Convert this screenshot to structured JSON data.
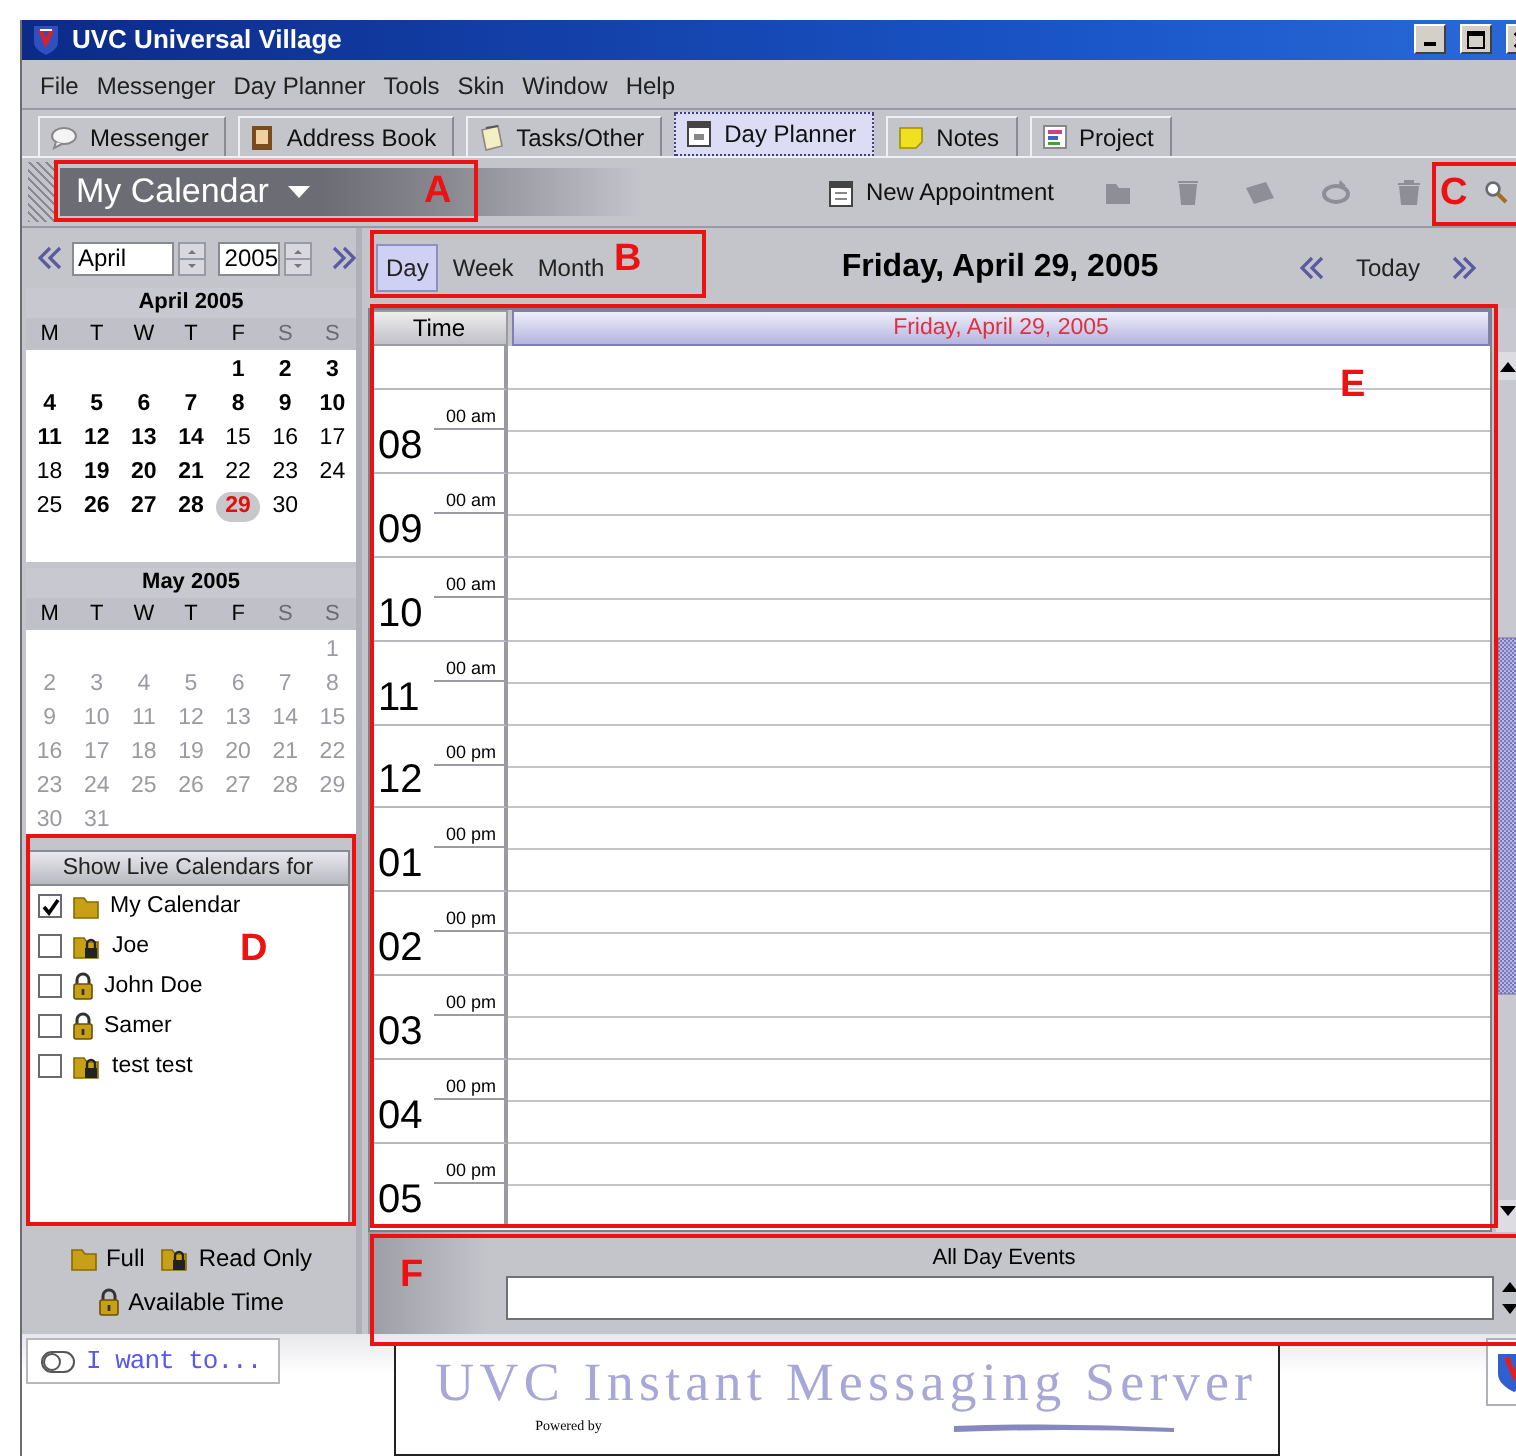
{
  "window": {
    "title": "UVC Universal Village"
  },
  "menu": [
    {
      "label": "File"
    },
    {
      "label": "Messenger"
    },
    {
      "label": "Day Planner"
    },
    {
      "label": "Tools"
    },
    {
      "label": "Skin"
    },
    {
      "label": "Window"
    },
    {
      "label": "Help"
    }
  ],
  "tabs": [
    {
      "label": "Messenger",
      "selected": false
    },
    {
      "label": "Address Book",
      "selected": false
    },
    {
      "label": "Tasks/Other",
      "selected": false
    },
    {
      "label": "Day Planner",
      "selected": true
    },
    {
      "label": "Notes",
      "selected": false
    },
    {
      "label": "Project",
      "selected": false
    }
  ],
  "toolbar": {
    "calendar": "My Calendar",
    "new_appointment": "New Appointment"
  },
  "mini_calendar": {
    "month": "April",
    "year": "2005",
    "months": [
      {
        "title": "April 2005",
        "dimmed": false,
        "weekdays": [
          "M",
          "T",
          "W",
          "T",
          "F",
          "S",
          "S"
        ],
        "weeks": [
          [
            {
              "day": "1",
              "bold": true,
              "selected": false
            },
            {
              "day": "2",
              "bold": true,
              "selected": false
            },
            {
              "day": "3",
              "bold": true,
              "selected": false
            }
          ],
          [
            {
              "day": "4",
              "bold": true,
              "selected": false
            },
            {
              "day": "5",
              "bold": true,
              "selected": false
            },
            {
              "day": "6",
              "bold": true,
              "selected": false
            },
            {
              "day": "7",
              "bold": true,
              "selected": false
            },
            {
              "day": "8",
              "bold": true,
              "selected": false
            },
            {
              "day": "9",
              "bold": true,
              "selected": false
            },
            {
              "day": "10",
              "bold": true,
              "selected": false
            }
          ],
          [
            {
              "day": "11",
              "bold": true,
              "selected": false
            },
            {
              "day": "12",
              "bold": true,
              "selected": false
            },
            {
              "day": "13",
              "bold": true,
              "selected": false
            },
            {
              "day": "14",
              "bold": true,
              "selected": false
            },
            {
              "day": "15",
              "bold": false,
              "selected": false
            },
            {
              "day": "16",
              "bold": false,
              "selected": false
            },
            {
              "day": "17",
              "bold": false,
              "selected": false
            }
          ],
          [
            {
              "day": "18",
              "bold": false,
              "selected": false
            },
            {
              "day": "19",
              "bold": true,
              "selected": false
            },
            {
              "day": "20",
              "bold": true,
              "selected": false
            },
            {
              "day": "21",
              "bold": true,
              "selected": false
            },
            {
              "day": "22",
              "bold": false,
              "selected": false
            },
            {
              "day": "23",
              "bold": false,
              "selected": false
            },
            {
              "day": "24",
              "bold": false,
              "selected": false
            }
          ],
          [
            {
              "day": "25",
              "bold": false,
              "selected": false
            },
            {
              "day": "26",
              "bold": true,
              "selected": false
            },
            {
              "day": "27",
              "bold": true,
              "selected": false
            },
            {
              "day": "28",
              "bold": true,
              "selected": false
            },
            {
              "day": "29",
              "bold": true,
              "selected": true
            },
            {
              "day": "30",
              "bold": false,
              "selected": false
            }
          ]
        ]
      },
      {
        "title": "May 2005",
        "dimmed": true,
        "weekdays": [
          "M",
          "T",
          "W",
          "T",
          "F",
          "S",
          "S"
        ],
        "weeks": [
          [
            {
              "day": "1",
              "bold": false,
              "selected": false
            }
          ],
          [
            {
              "day": "2",
              "bold": false,
              "selected": false
            },
            {
              "day": "3",
              "bold": false,
              "selected": false
            },
            {
              "day": "4",
              "bold": false,
              "selected": false
            },
            {
              "day": "5",
              "bold": false,
              "selected": false
            },
            {
              "day": "6",
              "bold": false,
              "selected": false
            },
            {
              "day": "7",
              "bold": false,
              "selected": false
            },
            {
              "day": "8",
              "bold": false,
              "selected": false
            }
          ],
          [
            {
              "day": "9",
              "bold": false,
              "selected": false
            },
            {
              "day": "10",
              "bold": false,
              "selected": false
            },
            {
              "day": "11",
              "bold": false,
              "selected": false
            },
            {
              "day": "12",
              "bold": false,
              "selected": false
            },
            {
              "day": "13",
              "bold": false,
              "selected": false
            },
            {
              "day": "14",
              "bold": false,
              "selected": false
            },
            {
              "day": "15",
              "bold": false,
              "selected": false
            }
          ],
          [
            {
              "day": "16",
              "bold": false,
              "selected": false
            },
            {
              "day": "17",
              "bold": false,
              "selected": false
            },
            {
              "day": "18",
              "bold": false,
              "selected": false
            },
            {
              "day": "19",
              "bold": false,
              "selected": false
            },
            {
              "day": "20",
              "bold": false,
              "selected": false
            },
            {
              "day": "21",
              "bold": false,
              "selected": false
            },
            {
              "day": "22",
              "bold": false,
              "selected": false
            }
          ],
          [
            {
              "day": "23",
              "bold": false,
              "selected": false
            },
            {
              "day": "24",
              "bold": false,
              "selected": false
            },
            {
              "day": "25",
              "bold": false,
              "selected": false
            },
            {
              "day": "26",
              "bold": false,
              "selected": false
            },
            {
              "day": "27",
              "bold": false,
              "selected": false
            },
            {
              "day": "28",
              "bold": false,
              "selected": false
            },
            {
              "day": "29",
              "bold": false,
              "selected": false
            }
          ],
          [
            {
              "day": "30",
              "bold": false,
              "selected": false
            },
            {
              "day": "31",
              "bold": false,
              "selected": false
            }
          ]
        ]
      }
    ]
  },
  "live_calendars": {
    "title": "Show Live Calendars for",
    "items": [
      {
        "name": "My Calendar",
        "checked": true,
        "kind": "full"
      },
      {
        "name": "Joe",
        "checked": false,
        "kind": "read_only"
      },
      {
        "name": "John Doe",
        "checked": false,
        "kind": "available_time"
      },
      {
        "name": "Samer",
        "checked": false,
        "kind": "available_time"
      },
      {
        "name": "test test",
        "checked": false,
        "kind": "read_only"
      }
    ]
  },
  "legend": [
    {
      "kind": "full",
      "label": "Full"
    },
    {
      "kind": "read_only",
      "label": "Read Only"
    },
    {
      "kind": "available_time",
      "label": "Available Time"
    }
  ],
  "view": {
    "modes": [
      {
        "label": "Day",
        "selected": true
      },
      {
        "label": "Week",
        "selected": false
      },
      {
        "label": "Month",
        "selected": false
      }
    ],
    "date_title": "Friday, April 29, 2005",
    "today": "Today"
  },
  "day_grid": {
    "time_header": "Time",
    "day_header": "Friday, April 29, 2005",
    "hours": [
      {
        "hour": "08",
        "minutes": "00 am"
      },
      {
        "hour": "09",
        "minutes": "00 am"
      },
      {
        "hour": "10",
        "minutes": "00 am"
      },
      {
        "hour": "11",
        "minutes": "00 am"
      },
      {
        "hour": "12",
        "minutes": "00 pm"
      },
      {
        "hour": "01",
        "minutes": "00 pm"
      },
      {
        "hour": "02",
        "minutes": "00 pm"
      },
      {
        "hour": "03",
        "minutes": "00 pm"
      },
      {
        "hour": "04",
        "minutes": "00 pm"
      },
      {
        "hour": "05",
        "minutes": "00 pm"
      }
    ]
  },
  "all_day": {
    "label": "All Day Events"
  },
  "footer": {
    "i_want_to": "I want to...",
    "banner": "UVC Instant Messaging Server",
    "powered_by": "Powered by"
  },
  "annotations": [
    {
      "label": "A"
    },
    {
      "label": "B"
    },
    {
      "label": "C"
    },
    {
      "label": "D"
    },
    {
      "label": "E"
    },
    {
      "label": "F"
    }
  ]
}
